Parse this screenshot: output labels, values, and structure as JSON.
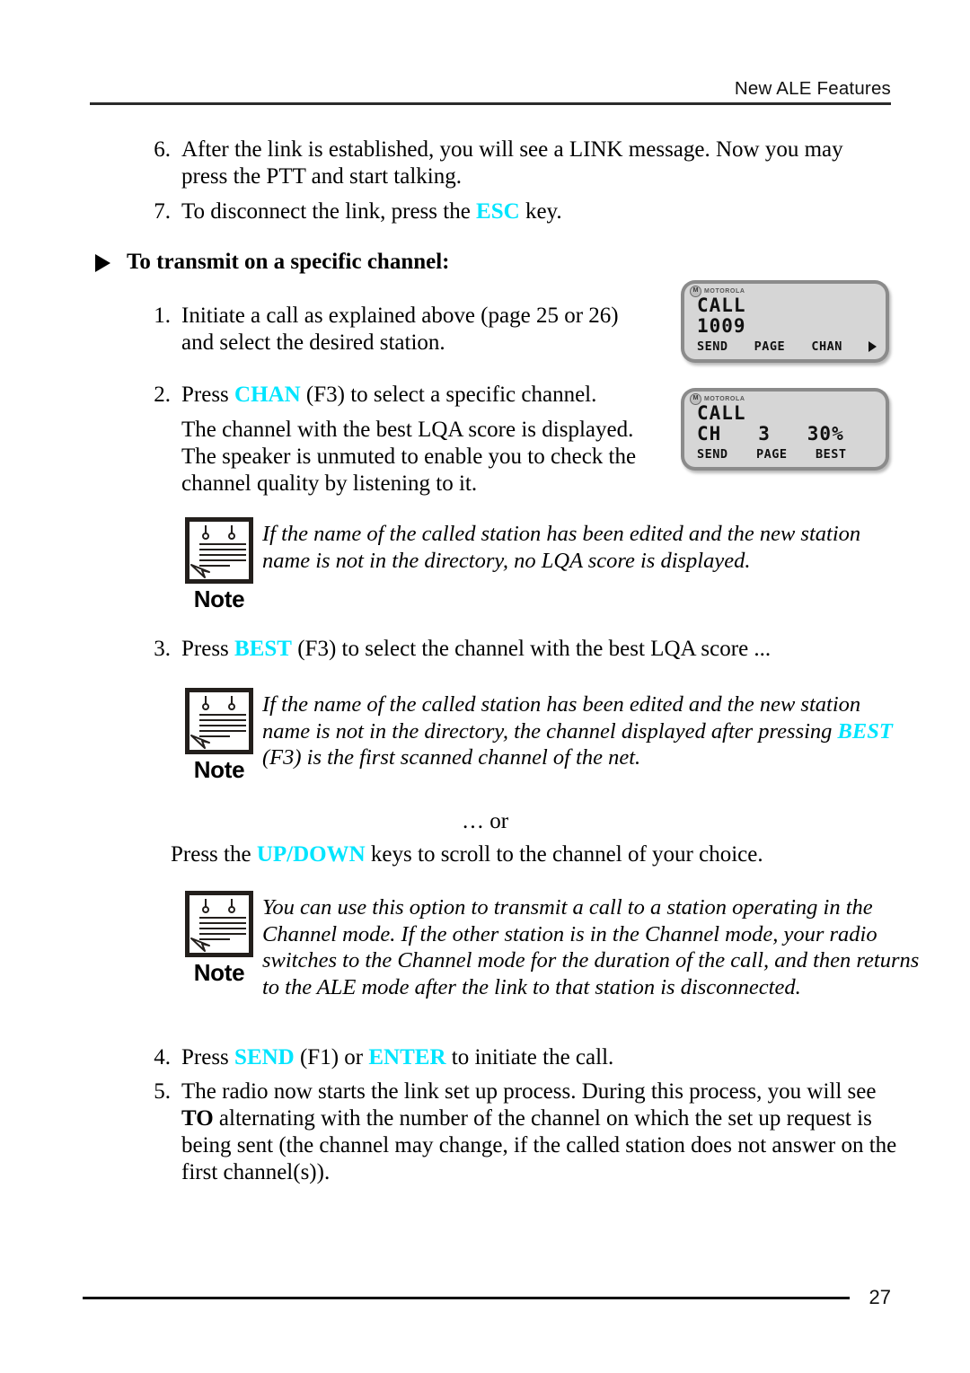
{
  "header": {
    "title": "New ALE Features"
  },
  "steps_top": [
    {
      "number": "6.",
      "text": "After the link is established, you will see a LINK message. Now you may press the PTT and start talking."
    },
    {
      "number": "7.",
      "text_before": "To disconnect the link, press the ",
      "key": "ESC",
      "text_after": " key."
    }
  ],
  "section_heading": {
    "bullet": "arrow-bullet",
    "text": "To transmit on a specific channel:"
  },
  "steps": [
    {
      "number": "1.",
      "text": "Initiate a call as explained above (page 25 or 26) and select the desired station."
    },
    {
      "number": "2.",
      "text_before": "Press ",
      "key": "CHAN",
      "text_after": " (F3) to select a specific channel.",
      "body": "The channel with the best LQA score is displayed. The speaker is unmuted to enable you to check the channel quality by listening to it."
    },
    {
      "number": "3.",
      "text_before": "Press ",
      "key": "BEST",
      "text_after": " (F3) to select the channel with the best LQA score ..."
    },
    {
      "number": "4.",
      "text_before": "Press ",
      "key": "SEND",
      "text_mid": " (F1) or ",
      "key2": "ENTER",
      "text_after": " to initiate the call."
    },
    {
      "number": "5.",
      "text_a": "The radio now starts the link set up process. During this process, you will see ",
      "bold": "TO",
      "text_b": " alternating with the number of the channel on which the set up request is being sent (the channel may change, if the called station does not answer on the first channel(s))."
    }
  ],
  "notes": [
    {
      "label": "Note",
      "text": "If the name of the called station has been edited and the new station name is not in the directory, no LQA score is displayed."
    },
    {
      "label": "Note",
      "text_before": "If the name of the called station has been edited and the new station name is not in the directory, the channel displayed after pressing ",
      "key": "BEST",
      "text_after": " (F3) is the first scanned channel of the net."
    },
    {
      "label": "Note",
      "text": "You can use this option to transmit a call to a station operating in the Channel mode. If the other station is in the Channel mode, your radio switches to the Channel mode for the duration of the call, and then returns to the ALE mode after the link to that station is disconnected."
    }
  ],
  "or_separator": "… or",
  "scroll_instruction": {
    "text_before": "Press the ",
    "key_up": "UP",
    "separator": "/",
    "key_down": "DOWN",
    "text_after": " keys to scroll to the channel of your choice."
  },
  "lcd_displays": [
    {
      "brand_mark": "M",
      "brand": "MOTOROLA",
      "line1": "CALL",
      "line2": "1009",
      "softkeys": [
        "SEND",
        "PAGE",
        "CHAN"
      ],
      "more_arrow": true
    },
    {
      "brand_mark": "M",
      "brand": "MOTOROLA",
      "line1": "CALL",
      "line2": "CH   3   30%",
      "softkeys": [
        "SEND",
        "PAGE",
        "BEST"
      ],
      "more_arrow": false
    }
  ],
  "footer": {
    "page_number": "27"
  },
  "colors": {
    "key_highlight": "#00e5ff",
    "lcd_bezel": "#8b8b8b",
    "lcd_screen": "#d6d6d6"
  }
}
